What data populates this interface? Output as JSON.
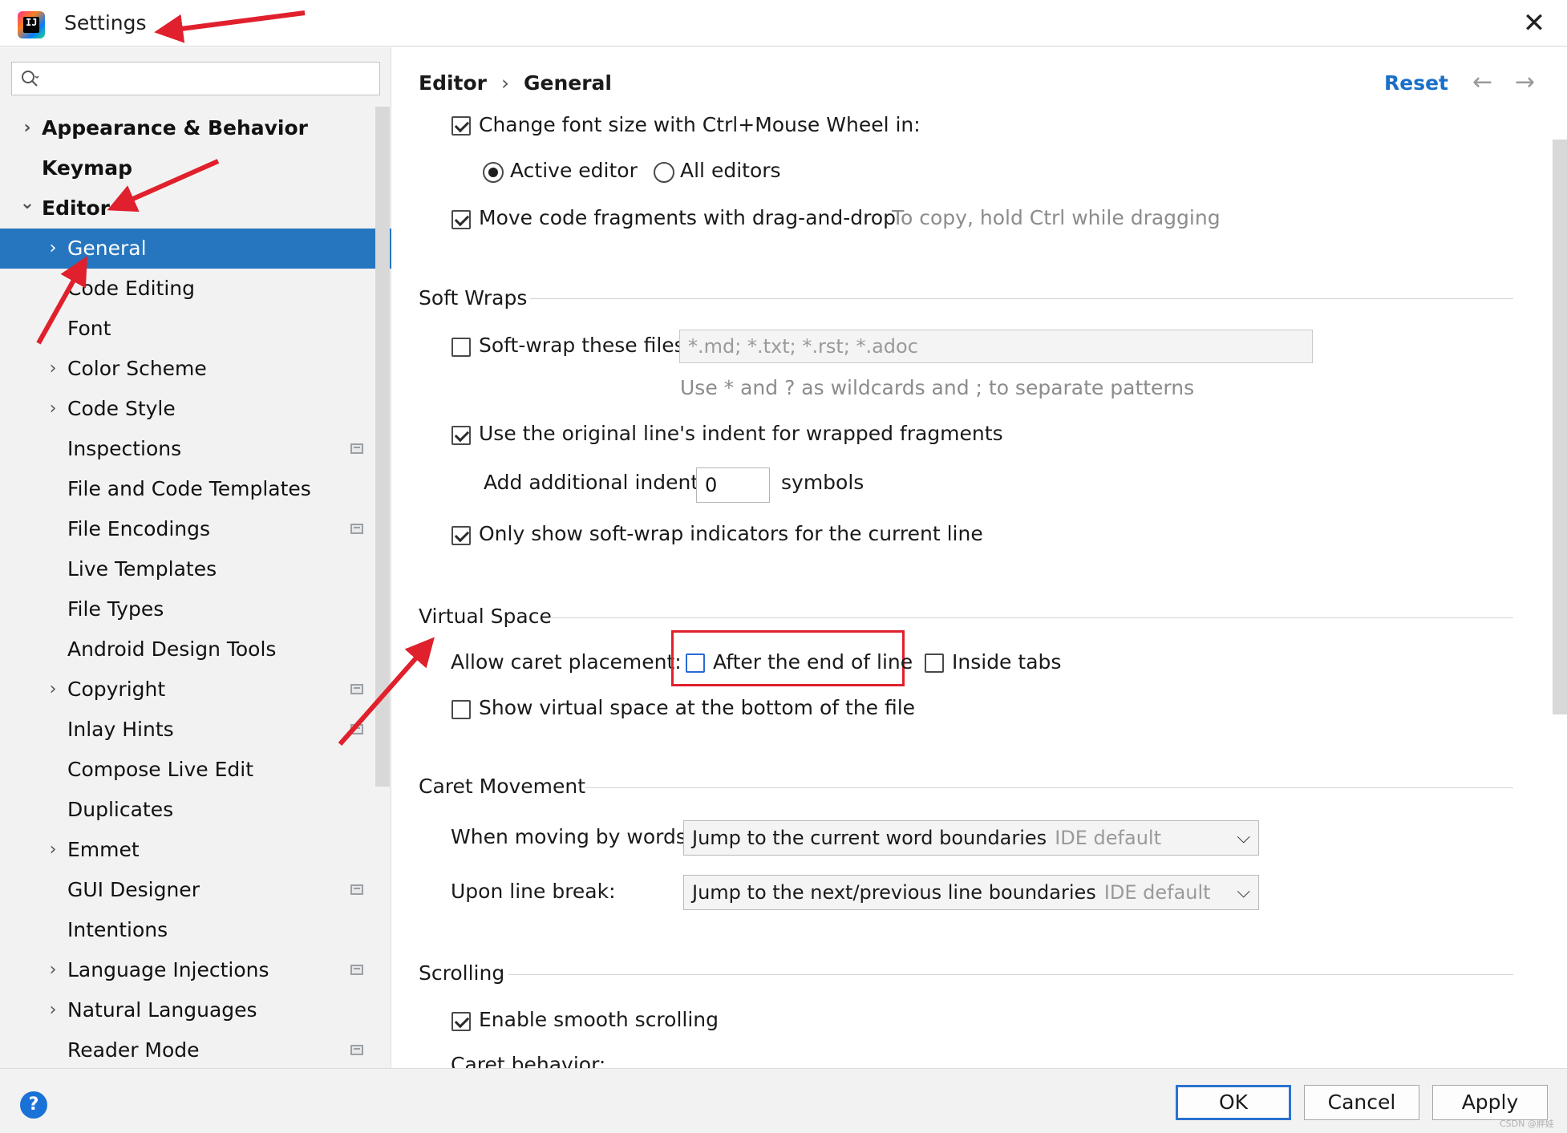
{
  "window": {
    "title": "Settings",
    "close_glyph": "✕"
  },
  "sidebar": {
    "search": {
      "value": "",
      "placeholder": ""
    },
    "items": [
      {
        "label": "Appearance & Behavior",
        "bold": true,
        "expandable": true,
        "expanded": false,
        "level": 0
      },
      {
        "label": "Keymap",
        "bold": true,
        "expandable": false,
        "level": 0
      },
      {
        "label": "Editor",
        "bold": true,
        "expandable": true,
        "expanded": true,
        "level": 0
      },
      {
        "label": "General",
        "expandable": true,
        "expanded": false,
        "level": 1,
        "selected": true
      },
      {
        "label": "Code Editing",
        "expandable": false,
        "level": 1
      },
      {
        "label": "Font",
        "expandable": false,
        "level": 1
      },
      {
        "label": "Color Scheme",
        "expandable": true,
        "level": 1
      },
      {
        "label": "Code Style",
        "expandable": true,
        "level": 1
      },
      {
        "label": "Inspections",
        "expandable": false,
        "level": 1,
        "project_icon": true
      },
      {
        "label": "File and Code Templates",
        "expandable": false,
        "level": 1
      },
      {
        "label": "File Encodings",
        "expandable": false,
        "level": 1,
        "project_icon": true
      },
      {
        "label": "Live Templates",
        "expandable": false,
        "level": 1
      },
      {
        "label": "File Types",
        "expandable": false,
        "level": 1
      },
      {
        "label": "Android Design Tools",
        "expandable": false,
        "level": 1
      },
      {
        "label": "Copyright",
        "expandable": true,
        "level": 1,
        "project_icon": true
      },
      {
        "label": "Inlay Hints",
        "expandable": false,
        "level": 1,
        "project_icon": true
      },
      {
        "label": "Compose Live Edit",
        "expandable": false,
        "level": 1
      },
      {
        "label": "Duplicates",
        "expandable": false,
        "level": 1
      },
      {
        "label": "Emmet",
        "expandable": true,
        "level": 1
      },
      {
        "label": "GUI Designer",
        "expandable": false,
        "level": 1,
        "project_icon": true
      },
      {
        "label": "Intentions",
        "expandable": false,
        "level": 1
      },
      {
        "label": "Language Injections",
        "expandable": true,
        "level": 1,
        "project_icon": true
      },
      {
        "label": "Natural Languages",
        "expandable": true,
        "level": 1
      },
      {
        "label": "Reader Mode",
        "expandable": false,
        "level": 1,
        "project_icon": true
      }
    ]
  },
  "main": {
    "breadcrumb": {
      "parent": "Editor",
      "separator": "›",
      "current": "General"
    },
    "reset_label": "Reset",
    "back_glyph": "←",
    "forward_glyph": "→",
    "mouse_wheel": {
      "label": "Change font size with Ctrl+Mouse Wheel in:",
      "checked": true,
      "options": [
        {
          "label": "Active editor",
          "selected": true
        },
        {
          "label": "All editors",
          "selected": false
        }
      ]
    },
    "drag_drop": {
      "label": "Move code fragments with drag-and-drop",
      "checked": true,
      "hint": "To copy, hold Ctrl while dragging"
    },
    "soft_wraps": {
      "title": "Soft Wraps",
      "wrap_files_label": "Soft-wrap these files:",
      "wrap_files_checked": false,
      "wrap_files_value": "*.md; *.txt; *.rst; *.adoc",
      "wrap_files_hint": "Use * and ? as wildcards and ; to separate patterns",
      "original_indent_label": "Use the original line's indent for wrapped fragments",
      "original_indent_checked": true,
      "additional_indent_label": "Add additional indent:",
      "additional_indent_value": "0",
      "additional_indent_unit": "symbols",
      "indicators_label": "Only show soft-wrap indicators for the current line",
      "indicators_checked": true
    },
    "virtual_space": {
      "title": "Virtual Space",
      "caret_label": "Allow caret placement:",
      "after_end_label": "After the end of line",
      "after_end_checked": false,
      "inside_tabs_label": "Inside tabs",
      "inside_tabs_checked": false,
      "show_bottom_label": "Show virtual space at the bottom of the file",
      "show_bottom_checked": false
    },
    "caret_movement": {
      "title": "Caret Movement",
      "words_label": "When moving by words:",
      "words_value": "Jump to the current word boundaries",
      "words_default": "IDE default",
      "linebreak_label": "Upon line break:",
      "linebreak_value": "Jump to the next/previous line boundaries",
      "linebreak_default": "IDE default",
      "chevron": "⌵"
    },
    "scrolling": {
      "title": "Scrolling",
      "smooth_label": "Enable smooth scrolling",
      "smooth_checked": true,
      "caret_behavior_label": "Caret behavior:"
    }
  },
  "footer": {
    "help_glyph": "?",
    "ok_label": "OK",
    "cancel_label": "Cancel",
    "apply_label": "Apply",
    "watermark": "CSDN @胖娃"
  },
  "colors": {
    "selection": "#2675bf",
    "link": "#1a6fc9",
    "annotation": "#e0202c"
  }
}
